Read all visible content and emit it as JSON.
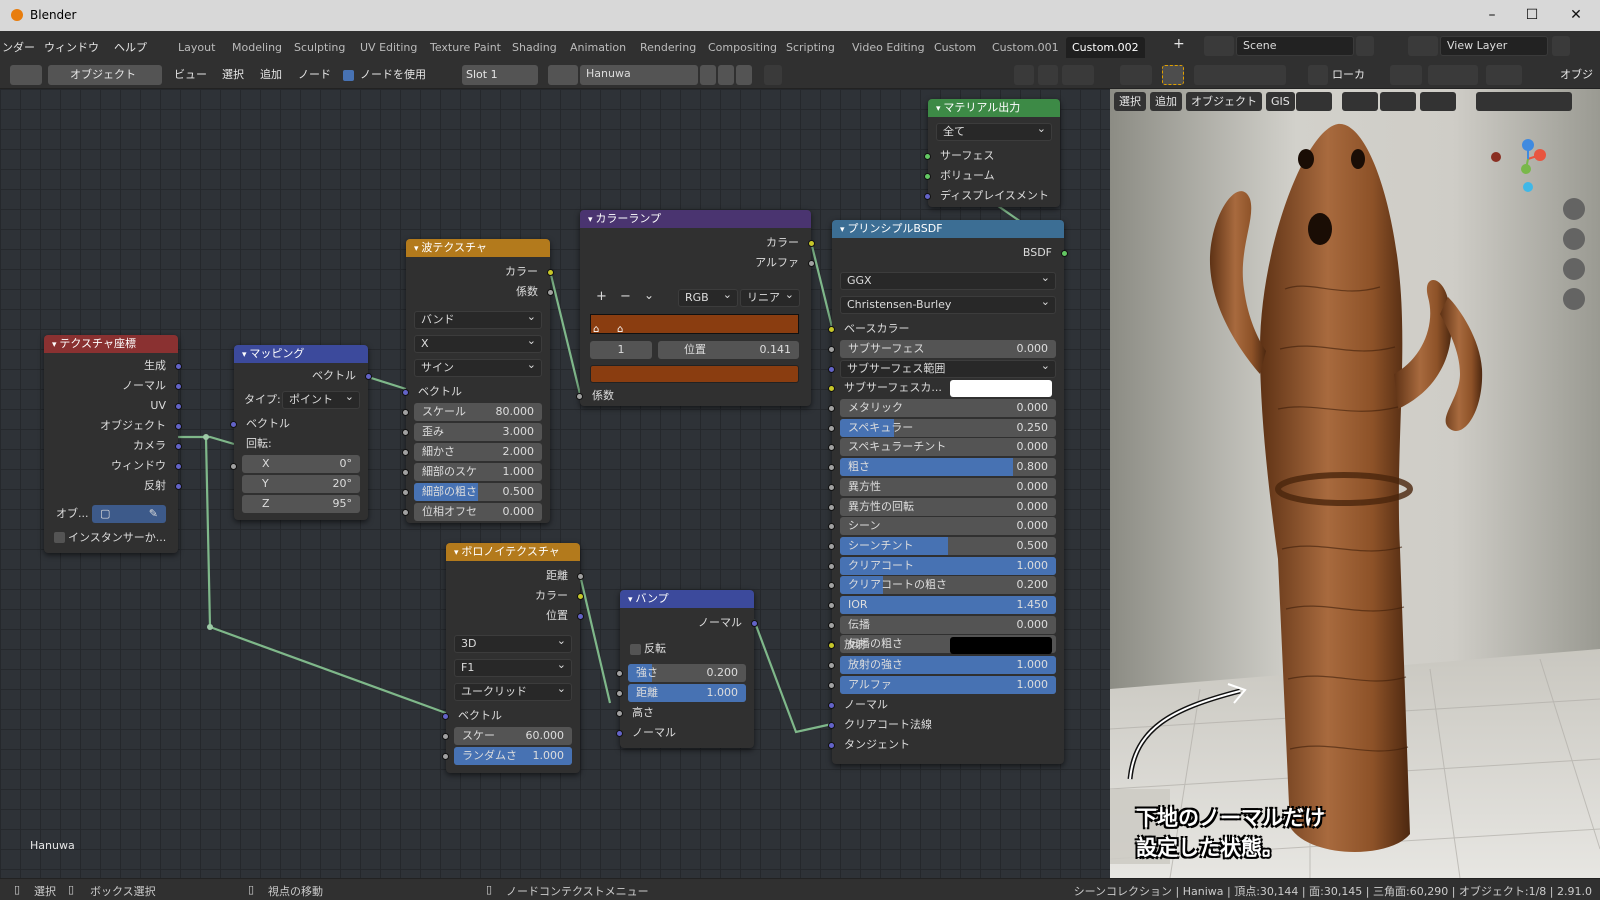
{
  "window": {
    "title": "Blender",
    "minimize": "–",
    "maximize": "☐",
    "close": "✕"
  },
  "menu": {
    "render_partial": "ンダー",
    "window": "ウィンドウ",
    "help": "ヘルプ"
  },
  "tabs": [
    "Layout",
    "Modeling",
    "Sculpting",
    "UV Editing",
    "Texture Paint",
    "Shading",
    "Animation",
    "Rendering",
    "Compositing",
    "Scripting",
    "Video Editing",
    "Custom",
    "Custom.001",
    "Custom.002"
  ],
  "active_tab": "Custom.002",
  "add_tab": "+",
  "scene": "Scene",
  "view_layer": "View Layer",
  "node_header": {
    "mode": "オブジェクト",
    "view": "ビュー",
    "select": "選択",
    "add": "追加",
    "node": "ノード",
    "use_nodes": "ノードを使用",
    "slot": "Slot 1",
    "material": "Hanuwa"
  },
  "vp_header": {
    "local": "ローカ",
    "select": "選択",
    "add": "追加",
    "object": "オブジェクト",
    "gis": "GIS",
    "cut": "オブジ"
  },
  "nodes": {
    "texcoord": {
      "title": "テクスチャ座標",
      "outputs": [
        "生成",
        "ノーマル",
        "UV",
        "オブジェクト",
        "カメラ",
        "ウィンドウ",
        "反射"
      ],
      "object_label": "オブ...",
      "instancer": "インスタンサーか..."
    },
    "mapping": {
      "title": "マッピング",
      "out_vector": "ベクトル",
      "type_label": "タイプ:",
      "type_value": "ポイント",
      "in_vector": "ベクトル",
      "rotation": "回転:",
      "x_label": "X",
      "x_value": "0°",
      "y_label": "Y",
      "y_value": "20°",
      "z_label": "Z",
      "z_value": "95°"
    },
    "wave": {
      "title": "波テクスチャ",
      "out_color": "カラー",
      "out_fac": "係数",
      "d1": "バンド",
      "d2": "X",
      "d3": "サイン",
      "in_vector": "ベクトル",
      "fields": [
        {
          "label": "スケール",
          "value": "80.000",
          "fill": 0
        },
        {
          "label": "歪み",
          "value": "3.000",
          "fill": 0
        },
        {
          "label": "細かさ",
          "value": "2.000",
          "fill": 0
        },
        {
          "label": "細部のスケ",
          "value": "1.000",
          "fill": 0
        },
        {
          "label": "細部の粗さ",
          "value": "0.500",
          "fill": 0.5
        },
        {
          "label": "位相オフセ",
          "value": "0.000",
          "fill": 0
        }
      ]
    },
    "ramp": {
      "title": "カラーランプ",
      "out_color": "カラー",
      "out_alpha": "アルファ",
      "plus": "+",
      "minus": "−",
      "chev": "⌄",
      "mode": "RGB",
      "interp": "リニア",
      "index": "1",
      "pos_label": "位置",
      "pos_value": "0.141",
      "in_fac": "係数",
      "color": "#8a3d10"
    },
    "voronoi": {
      "title": "ボロノイテクスチャ",
      "out_dist": "距離",
      "out_color": "カラー",
      "out_pos": "位置",
      "d1": "3D",
      "d2": "F1",
      "d3": "ユークリッド",
      "in_vector": "ベクトル",
      "scale_label": "スケー",
      "scale_value": "60.000",
      "rand_label": "ランダムさ",
      "rand_value": "1.000",
      "rand_fill": 1
    },
    "bump": {
      "title": "バンプ",
      "out_normal": "ノーマル",
      "invert": "反転",
      "str_label": "強さ",
      "str_value": "0.200",
      "str_fill": 0.2,
      "dist_label": "距離",
      "dist_value": "1.000",
      "dist_fill": 1,
      "height": "高さ",
      "in_normal": "ノーマル"
    },
    "output": {
      "title": "マテリアル出力",
      "target": "全て",
      "surface": "サーフェス",
      "volume": "ボリューム",
      "displacement": "ディスプレイスメント"
    },
    "bsdf": {
      "title": "プリンシプルBSDF",
      "out": "BSDF",
      "dist": "GGX",
      "sss_method": "Christensen-Burley",
      "base_color": "ベースカラー",
      "fields": [
        {
          "label": "サブサーフェス",
          "value": "0.000",
          "fill": 0
        },
        {
          "label": "メタリック",
          "value": "0.000",
          "fill": 0
        },
        {
          "label": "スペキュラー",
          "value": "0.250",
          "fill": 0.25
        },
        {
          "label": "スペキュラーチント",
          "value": "0.000",
          "fill": 0
        },
        {
          "label": "粗さ",
          "value": "0.800",
          "fill": 0.8
        },
        {
          "label": "異方性",
          "value": "0.000",
          "fill": 0
        },
        {
          "label": "異方性の回転",
          "value": "0.000",
          "fill": 0
        },
        {
          "label": "シーン",
          "value": "0.000",
          "fill": 0
        },
        {
          "label": "シーンチント",
          "value": "0.500",
          "fill": 0.5
        },
        {
          "label": "クリアコート",
          "value": "1.000",
          "fill": 1
        },
        {
          "label": "クリアコートの粗さ",
          "value": "0.200",
          "fill": 0.2
        },
        {
          "label": "IOR",
          "value": "1.450",
          "fill": 1
        },
        {
          "label": "伝播",
          "value": "0.000",
          "fill": 0
        },
        {
          "label": "伝播の粗さ",
          "value": "0.000",
          "fill": 0
        }
      ],
      "sss_radius": "サブサーフェス範囲",
      "sss_color": "サブサーフェスカ...",
      "emission": "放射",
      "fields2": [
        {
          "label": "放射の強さ",
          "value": "1.000",
          "fill": 1
        },
        {
          "label": "アルファ",
          "value": "1.000",
          "fill": 1
        }
      ],
      "normal": "ノーマル",
      "cc_normal": "クリアコート法線",
      "tangent": "タンジェント"
    }
  },
  "editor_label": "Hanuwa",
  "caption": {
    "line1": "下地のノーマルだけ",
    "line2": "設定した状態。"
  },
  "status": {
    "select": "選択",
    "box_select": "ボックス選択",
    "move_view": "視点の移動",
    "context_menu": "ノードコンテクストメニュー",
    "stats": "シーンコレクション | Haniwa | 頂点:30,144 | 面:30,145 | 三角面:60,290 | オブジェクト:1/8 | 2.91.0"
  }
}
